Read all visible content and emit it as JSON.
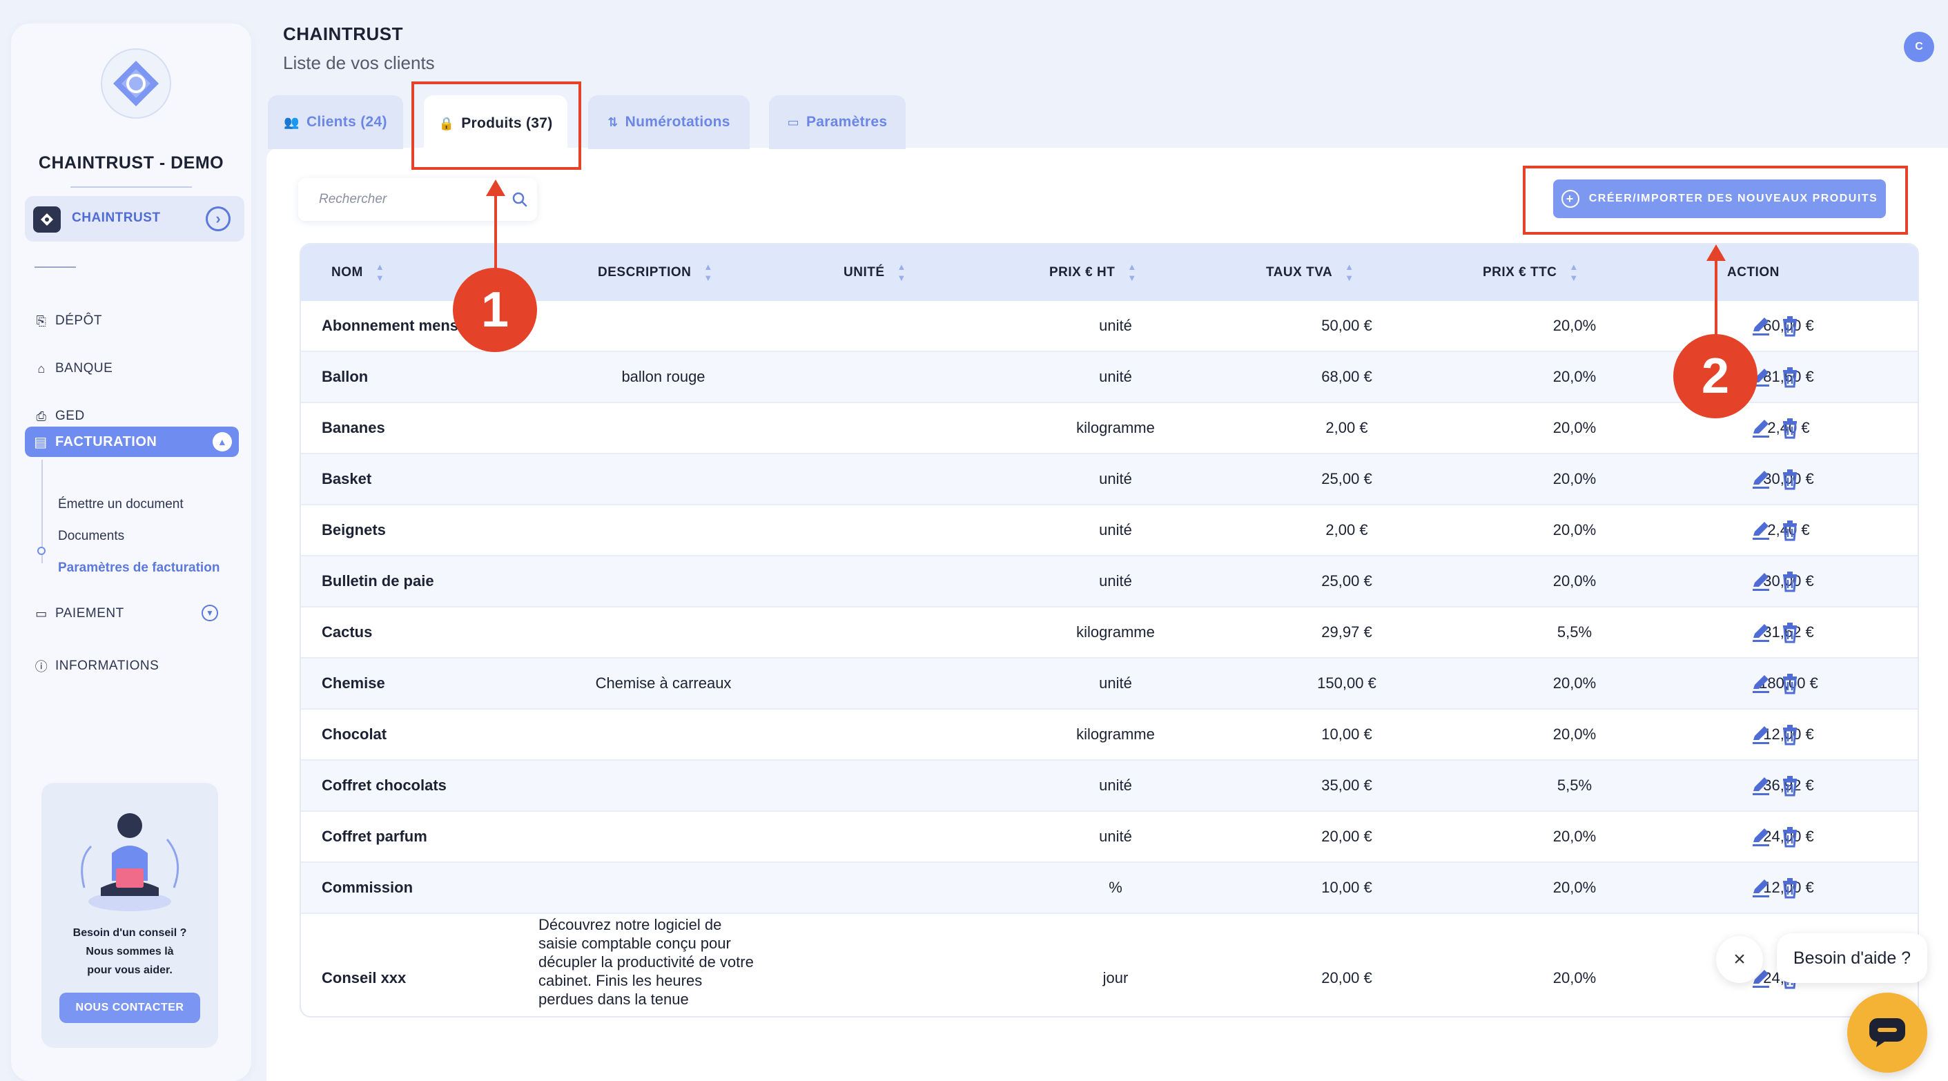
{
  "sidebar": {
    "brand": "CHAINTRUST - DEMO",
    "company": "CHAINTRUST",
    "nav": {
      "depot": "DÉPÔT",
      "banque": "BANQUE",
      "ged": "GED",
      "facturation": "FACTURATION",
      "paiement": "PAIEMENT",
      "informations": "INFORMATIONS"
    },
    "facturation_sub": [
      "Émettre un document",
      "Documents",
      "Paramètres de facturation"
    ],
    "help": {
      "line1": "Besoin d'un conseil ?",
      "line2": "Nous sommes là",
      "line3": "pour vous aider.",
      "button": "NOUS CONTACTER"
    }
  },
  "header": {
    "title": "CHAINTRUST",
    "subtitle": "Liste de vos clients",
    "avatar_initial": "C"
  },
  "tabs": [
    {
      "label": "Clients (24)",
      "icon": "users-icon"
    },
    {
      "label": "Produits (37)",
      "icon": "lock-icon",
      "active": true
    },
    {
      "label": "Numérotations",
      "icon": "sort-arrows-icon"
    },
    {
      "label": "Paramètres",
      "icon": "wallet-icon"
    }
  ],
  "search": {
    "placeholder": "Rechercher"
  },
  "create_button": "CRÉER/IMPORTER DES NOUVEAUX PRODUITS",
  "table": {
    "headers": [
      "NOM",
      "DESCRIPTION",
      "UNITÉ",
      "PRIX € HT",
      "TAUX TVA",
      "PRIX € TTC",
      "ACTION"
    ],
    "rows": [
      {
        "nom": "Abonnement mensuel",
        "description": "",
        "unite": "unité",
        "ht": "50,00 €",
        "tva": "20,0%",
        "ttc": "60,00 €"
      },
      {
        "nom": "Ballon",
        "description": "ballon rouge",
        "unite": "unité",
        "ht": "68,00 €",
        "tva": "20,0%",
        "ttc": "81,60 €"
      },
      {
        "nom": "Bananes",
        "description": "",
        "unite": "kilogramme",
        "ht": "2,00 €",
        "tva": "20,0%",
        "ttc": "2,40 €"
      },
      {
        "nom": "Basket",
        "description": "",
        "unite": "unité",
        "ht": "25,00 €",
        "tva": "20,0%",
        "ttc": "30,00 €"
      },
      {
        "nom": "Beignets",
        "description": "",
        "unite": "unité",
        "ht": "2,00 €",
        "tva": "20,0%",
        "ttc": "2,40 €"
      },
      {
        "nom": "Bulletin de paie",
        "description": "",
        "unite": "unité",
        "ht": "25,00 €",
        "tva": "20,0%",
        "ttc": "30,00 €"
      },
      {
        "nom": "Cactus",
        "description": "",
        "unite": "kilogramme",
        "ht": "29,97 €",
        "tva": "5,5%",
        "ttc": "31,62 €"
      },
      {
        "nom": "Chemise",
        "description": "Chemise à carreaux",
        "unite": "unité",
        "ht": "150,00 €",
        "tva": "20,0%",
        "ttc": "180,00 €"
      },
      {
        "nom": "Chocolat",
        "description": "",
        "unite": "kilogramme",
        "ht": "10,00 €",
        "tva": "20,0%",
        "ttc": "12,00 €"
      },
      {
        "nom": "Coffret chocolats",
        "description": "",
        "unite": "unité",
        "ht": "35,00 €",
        "tva": "5,5%",
        "ttc": "36,92 €"
      },
      {
        "nom": "Coffret parfum",
        "description": "",
        "unite": "unité",
        "ht": "20,00 €",
        "tva": "20,0%",
        "ttc": "24,00 €"
      },
      {
        "nom": "Commission",
        "description": "",
        "unite": "%",
        "ht": "10,00 €",
        "tva": "20,0%",
        "ttc": "12,00 €"
      }
    ],
    "last_row": {
      "nom": "Conseil xxx",
      "description": "Découvrez notre logiciel de saisie comptable conçu pour décupler la productivité de votre cabinet. Finis les heures perdues dans la tenue",
      "unite": "jour",
      "ht": "20,00 €",
      "tva": "20,0%",
      "ttc": "24,00 €"
    }
  },
  "annotations": {
    "one": "1",
    "two": "2"
  },
  "chat": {
    "bubble": "Besoin d'aide ?"
  },
  "colors": {
    "accent": "#6f8cf0",
    "annotation": "#e4432a",
    "chat": "#f4b335"
  }
}
